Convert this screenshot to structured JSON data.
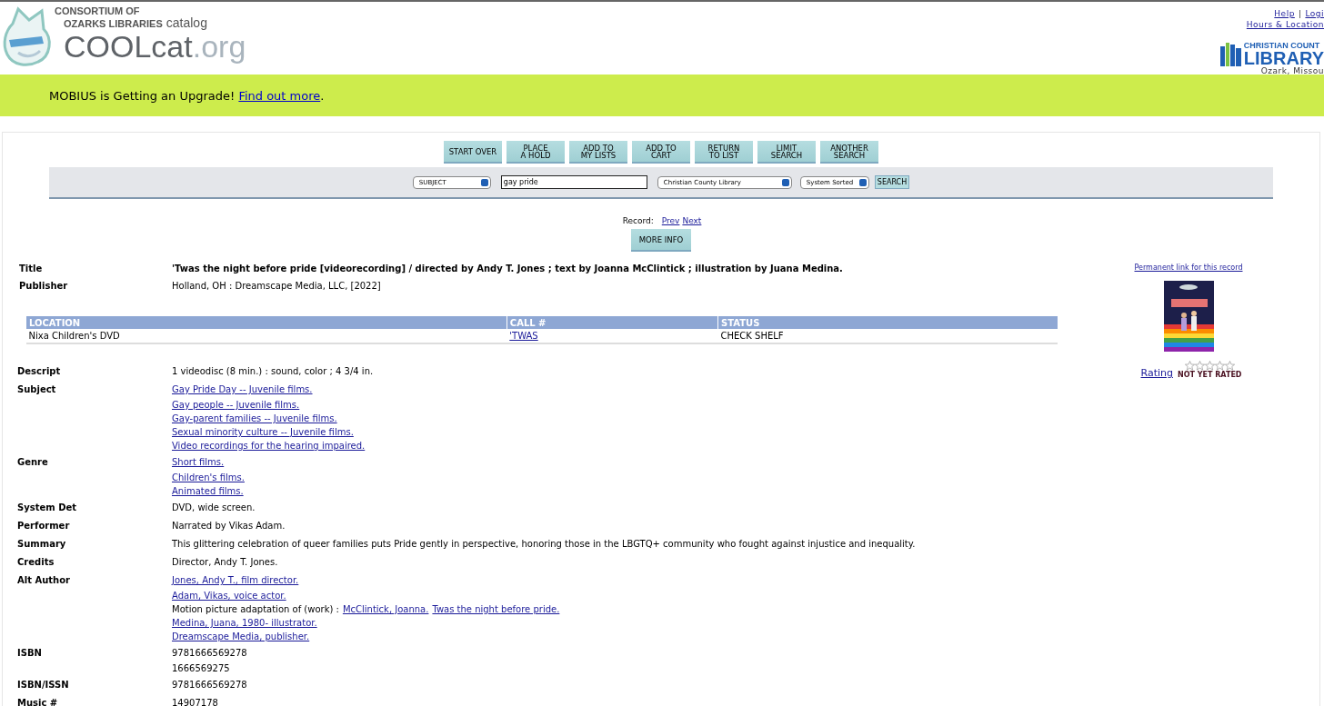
{
  "header": {
    "consortium": "CONSORTIUM OF",
    "libraries": "OZARKS LIBRARIES",
    "catalog": "catalog",
    "logo_main": "COOLcat",
    "logo_suffix": ".org",
    "top_links": [
      "Help",
      "|",
      "Logi"
    ],
    "hours": "Hours & Location",
    "library_logo": {
      "line1": "CHRISTIAN COUNT",
      "line2": "LIBRARY",
      "place": "Ozark, Missou"
    }
  },
  "banner": {
    "text": "MOBIUS is Getting an Upgrade!",
    "link": "Find out more",
    "end": "."
  },
  "buttons": [
    {
      "lines": [
        "START OVER"
      ]
    },
    {
      "lines": [
        "PLACE",
        "A HOLD"
      ]
    },
    {
      "lines": [
        "ADD TO",
        "MY LISTS"
      ]
    },
    {
      "lines": [
        "ADD TO",
        "CART"
      ]
    },
    {
      "lines": [
        "RETURN",
        "TO LIST"
      ]
    },
    {
      "lines": [
        "LIMIT",
        "SEARCH"
      ]
    },
    {
      "lines": [
        "ANOTHER",
        "SEARCH"
      ]
    }
  ],
  "search": {
    "type": "SUBJECT",
    "value": "gay pride",
    "scope": "Christian County Library",
    "sort": "System Sorted",
    "button": "SEARCH"
  },
  "record_nav": {
    "label": "Record:",
    "prev": "Prev",
    "next": "Next"
  },
  "more_info": "MORE INFO",
  "title": {
    "label": "Title",
    "value": "'Twas the night before pride [videorecording] / directed by Andy T. Jones ; text by Joanna McClintick ; illustration by Juana Medina."
  },
  "publisher": {
    "label": "Publisher",
    "value": "Holland, OH : Dreamscape Media, LLC, [2022]"
  },
  "holdings": {
    "columns": [
      "LOCATION",
      "CALL #",
      "STATUS"
    ],
    "rows": [
      {
        "location": "Nixa Children's DVD",
        "call": "'TWAS",
        "status": "CHECK SHELF"
      }
    ]
  },
  "fields": [
    {
      "label": "Descript",
      "lines": [
        [
          {
            "text": "1 videodisc (8 min.) : sound, color ; 4 3/4 in.",
            "link": false
          }
        ]
      ]
    },
    {
      "label": "Subject",
      "lines": [
        [
          {
            "text": "Gay Pride Day -- Juvenile films.",
            "link": true
          }
        ],
        [
          {
            "text": "Gay people -- Juvenile films.",
            "link": true
          }
        ],
        [
          {
            "text": "Gay-parent families -- Juvenile films.",
            "link": true
          }
        ],
        [
          {
            "text": "Sexual minority culture -- Juvenile films.",
            "link": true
          }
        ],
        [
          {
            "text": "Video recordings for the hearing impaired.",
            "link": true
          }
        ]
      ]
    },
    {
      "label": "Genre",
      "lines": [
        [
          {
            "text": "Short films.",
            "link": true
          }
        ],
        [
          {
            "text": "Children's films.",
            "link": true
          }
        ],
        [
          {
            "text": "Animated films.",
            "link": true
          }
        ]
      ]
    },
    {
      "label": "System Det",
      "lines": [
        [
          {
            "text": "DVD, wide screen.",
            "link": false
          }
        ]
      ]
    },
    {
      "label": "Performer",
      "lines": [
        [
          {
            "text": "Narrated by Vikas Adam.",
            "link": false
          }
        ]
      ]
    },
    {
      "label": "Summary",
      "lines": [
        [
          {
            "text": "This glittering celebration of queer families puts Pride gently in perspective, honoring those in the LBGTQ+ community who fought against injustice and inequality.",
            "link": false
          }
        ]
      ]
    },
    {
      "label": "Credits",
      "lines": [
        [
          {
            "text": "Director, Andy T. Jones.",
            "link": false
          }
        ]
      ]
    },
    {
      "label": "Alt Author",
      "lines": [
        [
          {
            "text": "Jones, Andy T., film director.",
            "link": true
          }
        ],
        [
          {
            "text": "Adam, Vikas, voice actor.",
            "link": true
          }
        ],
        [
          {
            "text": "Motion picture adaptation of (work) :",
            "link": false
          },
          {
            "text": "McClintick, Joanna.",
            "link": true
          },
          {
            "text": "Twas the night before pride.",
            "link": true
          }
        ],
        [
          {
            "text": "Medina, Juana, 1980- illustrator.",
            "link": true
          }
        ],
        [
          {
            "text": "Dreamscape Media, publisher.",
            "link": true
          }
        ]
      ]
    },
    {
      "label": "ISBN",
      "lines": [
        [
          {
            "text": "9781666569278",
            "link": false
          }
        ],
        [
          {
            "text": "1666569275",
            "link": false
          }
        ]
      ]
    },
    {
      "label": "ISBN/ISSN",
      "lines": [
        [
          {
            "text": "9781666569278",
            "link": false
          }
        ]
      ]
    },
    {
      "label": "Music #",
      "lines": [
        [
          {
            "text": "14907178",
            "link": false
          }
        ]
      ]
    }
  ],
  "side": {
    "permalink": "Permanent link for this record",
    "rating": "Rating",
    "stars": 0,
    "rating_note": "NOT YET RATED"
  }
}
